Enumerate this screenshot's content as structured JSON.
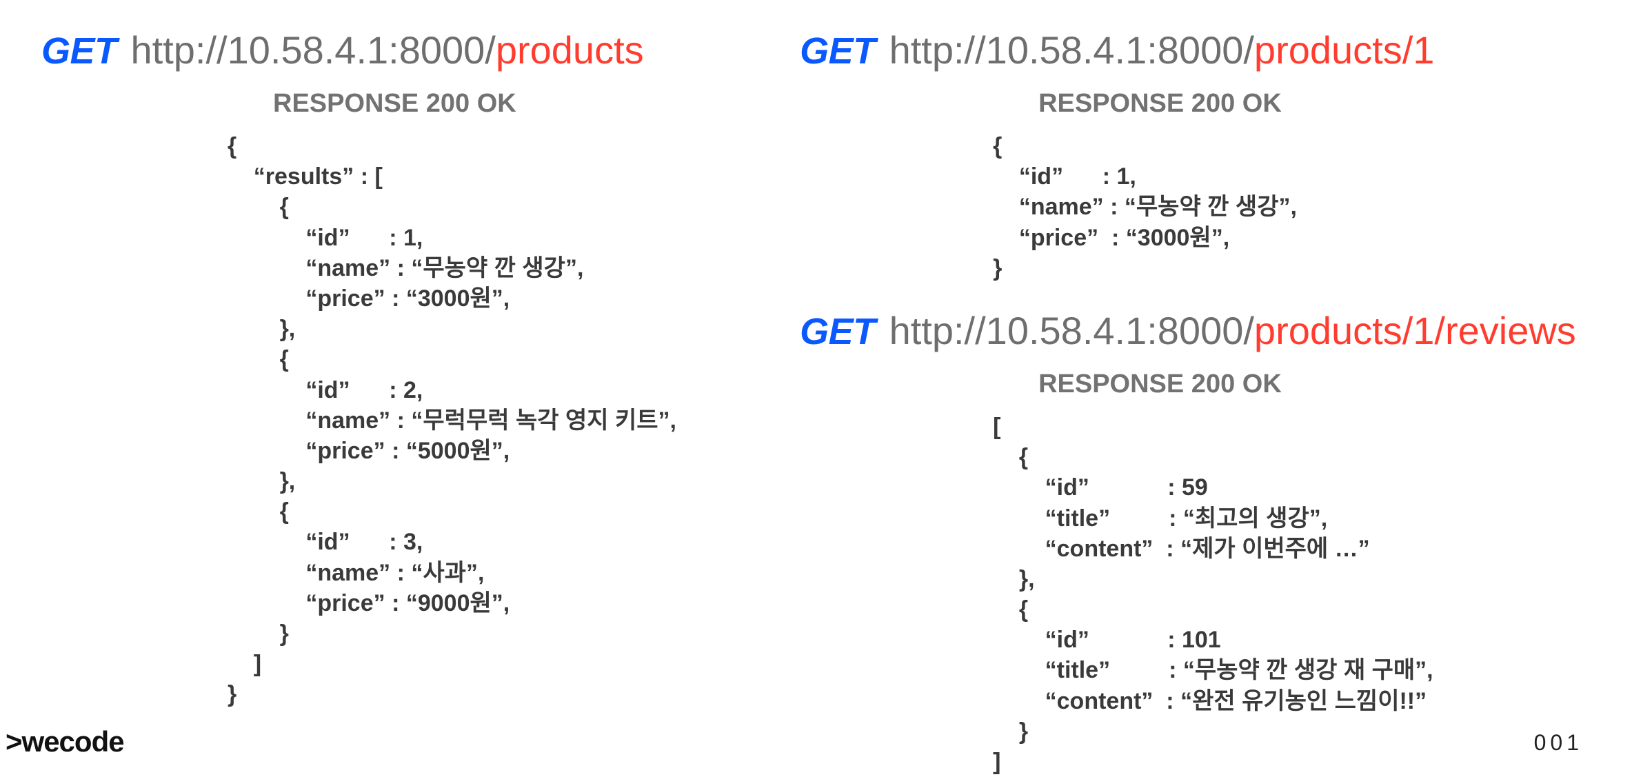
{
  "method_label": "GET",
  "url_base": "http://10.58.4.1:8000/",
  "endpoints": {
    "list": {
      "path": "products",
      "response_title": "RESPONSE 200 OK",
      "body": "{\n    “results” : [\n        {\n            “id”      : 1,\n            “name” : “무농약 깐 생강”,\n            “price” : “3000원”,\n        },\n        {\n            “id”      : 2,\n            “name” : “무럭무럭 녹각 영지 키트”,\n            “price” : “5000원”,\n        },\n        {\n            “id”      : 3,\n            “name” : “사과”,\n            “price” : “9000원”,\n        }\n    ]\n}"
    },
    "detail": {
      "path": "products/1",
      "response_title": "RESPONSE 200 OK",
      "body": "{\n    “id”      : 1,\n    “name” : “무농약 깐 생강”,\n    “price”  : “3000원”,\n}"
    },
    "reviews": {
      "path": "products/1/reviews",
      "response_title": "RESPONSE 200 OK",
      "body": "[\n    {\n        “id”            : 59\n        “title”         : “최고의 생강”,\n        “content”  : “제가 이번주에 …”\n    },\n    {\n        “id”            : 101\n        “title”         : “무농약 깐 생강 재 구매”,\n        “content”  : “완전 유기농인 느낌이!!”\n    }\n]"
    }
  },
  "footer": {
    "logo": ">wecode",
    "page": "001"
  }
}
